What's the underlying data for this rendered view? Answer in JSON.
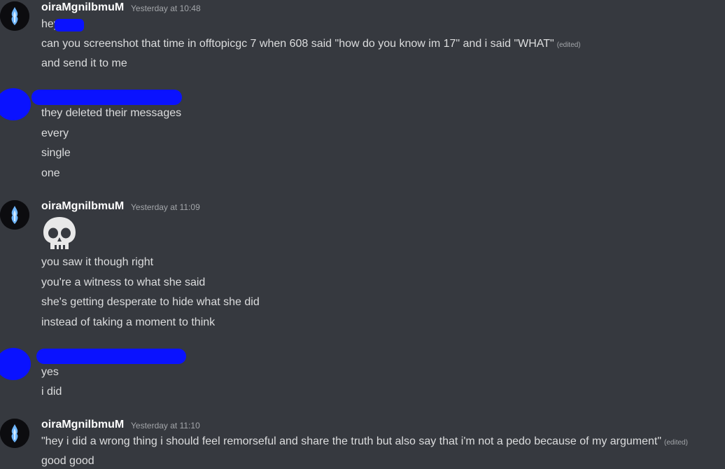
{
  "messages": [
    {
      "username": "oiraMgnilbmuM",
      "timestamp": "Yesterday at 10:48",
      "lines": [
        "hey",
        "can you screenshot that time in offtopicgc 7 when 608 said \"how do you know im 17\" and i said \"WHAT\"",
        "and send it to me"
      ],
      "edited_label": "(edited)"
    },
    {
      "lines": [
        "they deleted their messages",
        "every",
        "single",
        "one"
      ]
    },
    {
      "username": "oiraMgnilbmuM",
      "timestamp": "Yesterday at 11:09",
      "emoji": "skull-emoji",
      "lines": [
        "you saw it though right",
        "you're a witness to what she said",
        "she's getting desperate to hide what she did",
        "instead of taking a moment to think"
      ]
    },
    {
      "lines": [
        "yes",
        "i did"
      ]
    },
    {
      "username": "oiraMgnilbmuM",
      "timestamp": "Yesterday at 11:10",
      "lines": [
        "\"hey i did a wrong thing i should feel remorseful and share the truth but also say that i'm not a pedo because of my argument\"",
        "good good"
      ],
      "edited_label": "(edited)"
    }
  ],
  "colors": {
    "background": "#36393f",
    "text": "#dcddde",
    "username": "#ffffff",
    "timestamp": "#a3a6aa",
    "redaction": "#0a12ff"
  }
}
